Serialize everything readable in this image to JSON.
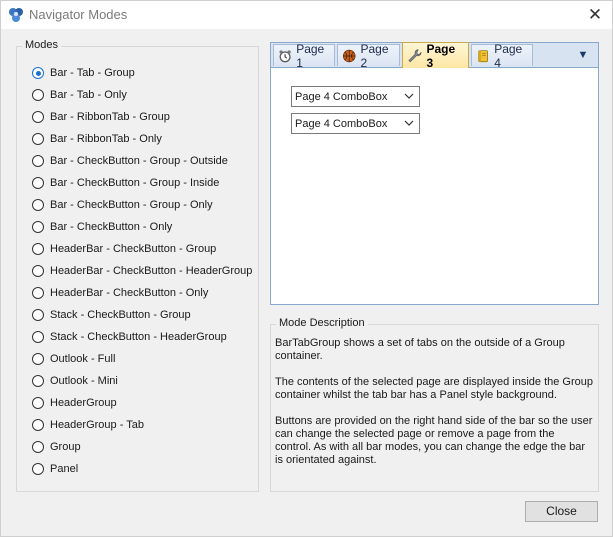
{
  "window": {
    "title": "Navigator Modes",
    "close_glyph": "✕"
  },
  "modes": {
    "legend": "Modes",
    "selected_index": 0,
    "items": [
      "Bar - Tab - Group",
      "Bar - Tab - Only",
      "Bar - RibbonTab - Group",
      "Bar - RibbonTab - Only",
      "Bar - CheckButton - Group - Outside",
      "Bar - CheckButton - Group - Inside",
      "Bar - CheckButton - Group - Only",
      "Bar - CheckButton - Only",
      "HeaderBar - CheckButton - Group",
      "HeaderBar - CheckButton - HeaderGroup",
      "HeaderBar - CheckButton - Only",
      "Stack - CheckButton - Group",
      "Stack - CheckButton - HeaderGroup",
      "Outlook - Full",
      "Outlook - Mini",
      "HeaderGroup",
      "HeaderGroup - Tab",
      "Group",
      "Panel"
    ]
  },
  "navigator": {
    "tabs": [
      {
        "label": "Page 1",
        "icon": "alarm-clock-icon",
        "selected": false
      },
      {
        "label": "Page 2",
        "icon": "basketball-icon",
        "selected": false
      },
      {
        "label": "Page 3",
        "icon": "wrench-icon",
        "selected": true
      },
      {
        "label": "Page 4",
        "icon": "notebook-icon",
        "selected": false
      }
    ],
    "menu_glyph": "▼",
    "combos": [
      {
        "value": "Page 4 ComboBox"
      },
      {
        "value": "Page 4 ComboBox"
      }
    ]
  },
  "description": {
    "legend": "Mode Description",
    "paragraphs": [
      "BarTabGroup shows a set of tabs on the outside of a Group container.",
      "The contents of the selected page are displayed inside the Group container whilst the tab bar has a Panel style background.",
      "Buttons are provided on the right hand side of the bar so the user can change the selected page or remove a page from the control. As with all bar modes, you can change the edge the bar is orientated against."
    ]
  },
  "buttons": {
    "close_label": "Close"
  },
  "colors": {
    "accent": "#1a6fd6",
    "tab_selected": "#fde6a4",
    "tabbar": "#d7e3f1"
  }
}
